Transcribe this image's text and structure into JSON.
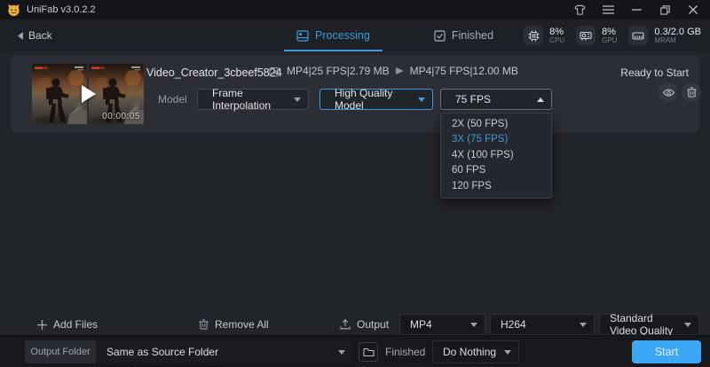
{
  "app": {
    "title": "UniFab v3.0.2.2"
  },
  "titlebar": {
    "icons": [
      "skin-icon",
      "menu-icon",
      "minimize-icon",
      "restore-icon",
      "close-icon"
    ]
  },
  "nav": {
    "back": "Back",
    "tabs": [
      {
        "label": "Processing",
        "active": true,
        "icon": "processing-queue-icon"
      },
      {
        "label": "Finished",
        "active": false,
        "icon": "finished-check-icon"
      }
    ],
    "stats": [
      {
        "value": "8%",
        "label": "CPU",
        "icon": "cpu-chip-icon"
      },
      {
        "value": "8%",
        "label": "GPU",
        "icon": "gpu-card-icon"
      },
      {
        "value": "0.3/2.0 GB",
        "label": "MRAM",
        "icon": "memory-icon"
      }
    ]
  },
  "file_card": {
    "title": "Video_Creator_3cbeef5824",
    "source_spec": "MP4|25 FPS|2.79 MB",
    "output_spec": "MP4|75 FPS|12.00 MB",
    "status": "Ready to Start",
    "duration": "00:00:05",
    "model_label": "Model",
    "model_select": "Frame Interpolation",
    "quality_select": "High Quality Model",
    "fps_select": "75 FPS",
    "fps_options": [
      {
        "label": "2X (50 FPS)",
        "selected": false
      },
      {
        "label": "3X (75 FPS)",
        "selected": true
      },
      {
        "label": "4X (100 FPS)",
        "selected": false
      },
      {
        "label": "60 FPS",
        "selected": false
      },
      {
        "label": "120 FPS",
        "selected": false
      }
    ]
  },
  "toolbar": {
    "add_files": "Add Files",
    "remove_all": "Remove All",
    "output_label": "Output",
    "format_select": "MP4",
    "codec_select": "H264",
    "quality_select": "Standard Video Quality"
  },
  "footer": {
    "output_folder_label": "Output Folder",
    "output_folder_select": "Same as Source Folder",
    "finished_label": "Finished",
    "finished_select": "Do Nothing",
    "start": "Start"
  },
  "colors": {
    "accent": "#3f9ddb",
    "start_button": "#3ba7f5",
    "selected_option": "#3f9ddb"
  }
}
